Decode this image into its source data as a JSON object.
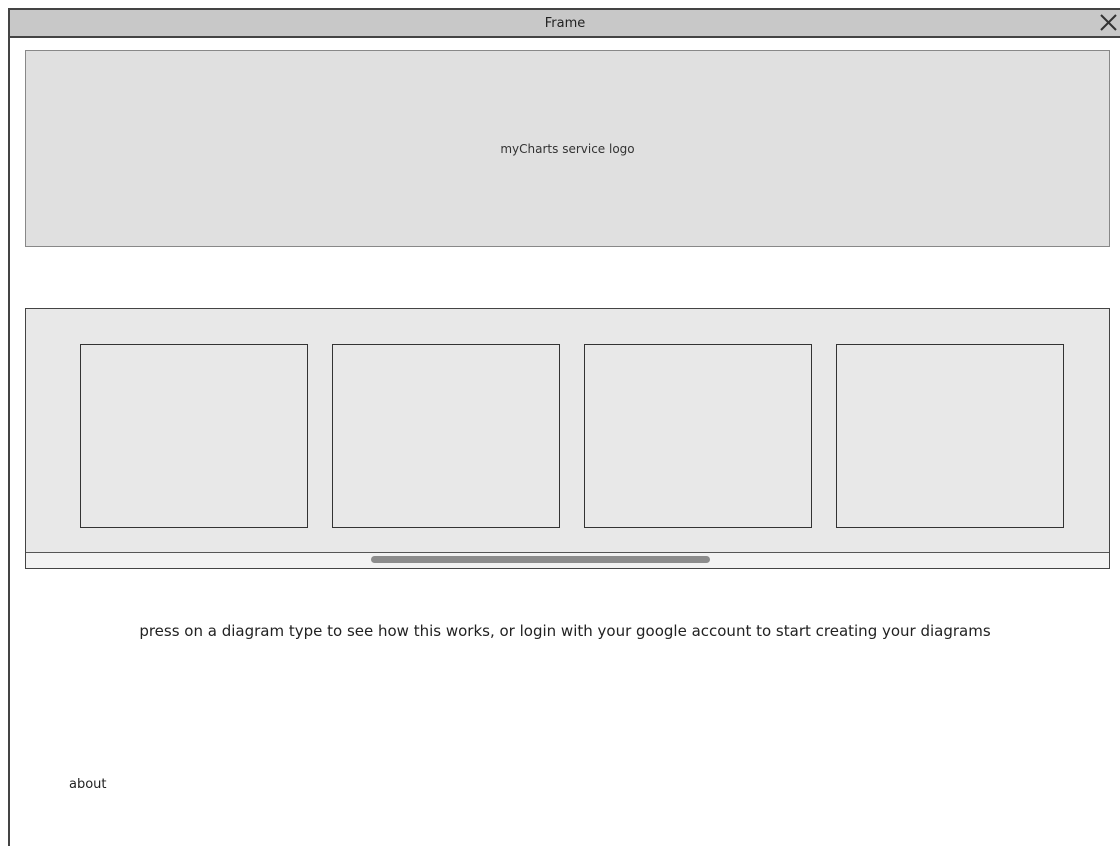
{
  "window": {
    "title": "Frame",
    "close_icon": "close-icon"
  },
  "logo": {
    "label": "myCharts service logo"
  },
  "carousel": {
    "cards": [
      {
        "label": ""
      },
      {
        "label": ""
      },
      {
        "label": ""
      },
      {
        "label": ""
      }
    ]
  },
  "instructions": {
    "text": "press on a diagram type to see how this works, or login with your google account to start creating your diagrams"
  },
  "footer": {
    "about_label": "about"
  }
}
